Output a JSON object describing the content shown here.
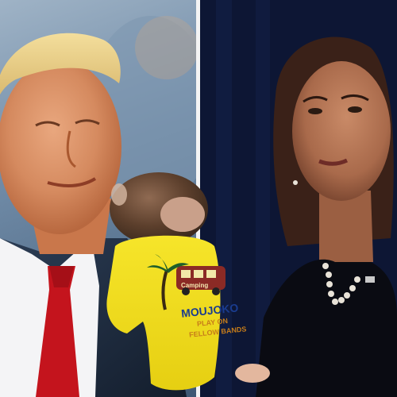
{
  "toy": {
    "shirt_brand": "MOUJOKO",
    "shirt_slogan_1": "PLAY ON",
    "shirt_slogan_2": "FELLOW BANDS",
    "bus_sign": "Camping"
  },
  "colors": {
    "divider": "#f4f4f4",
    "tie_red": "#c4141d",
    "shirt_yellow": "#f2e21c",
    "shirt_text_blue": "#1a3c8f"
  }
}
